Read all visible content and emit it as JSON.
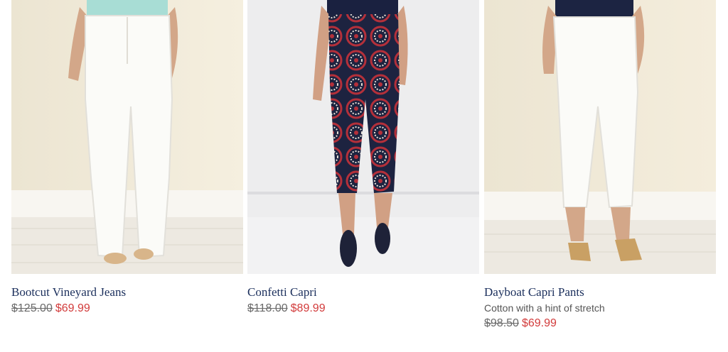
{
  "products": [
    {
      "name": "Bootcut Vineyard Jeans",
      "description": "",
      "original_price": "$125.00",
      "sale_price": "$69.99"
    },
    {
      "name": "Confetti Capri",
      "description": "",
      "original_price": "$118.00",
      "sale_price": "$89.99"
    },
    {
      "name": "Dayboat Capri Pants",
      "description": "Cotton with a hint of stretch",
      "original_price": "$98.50",
      "sale_price": "$69.99"
    }
  ],
  "colors": {
    "product_name": "#1b2f5c",
    "sale_price": "#d23b3b",
    "original_price": "#6a6a6a"
  }
}
